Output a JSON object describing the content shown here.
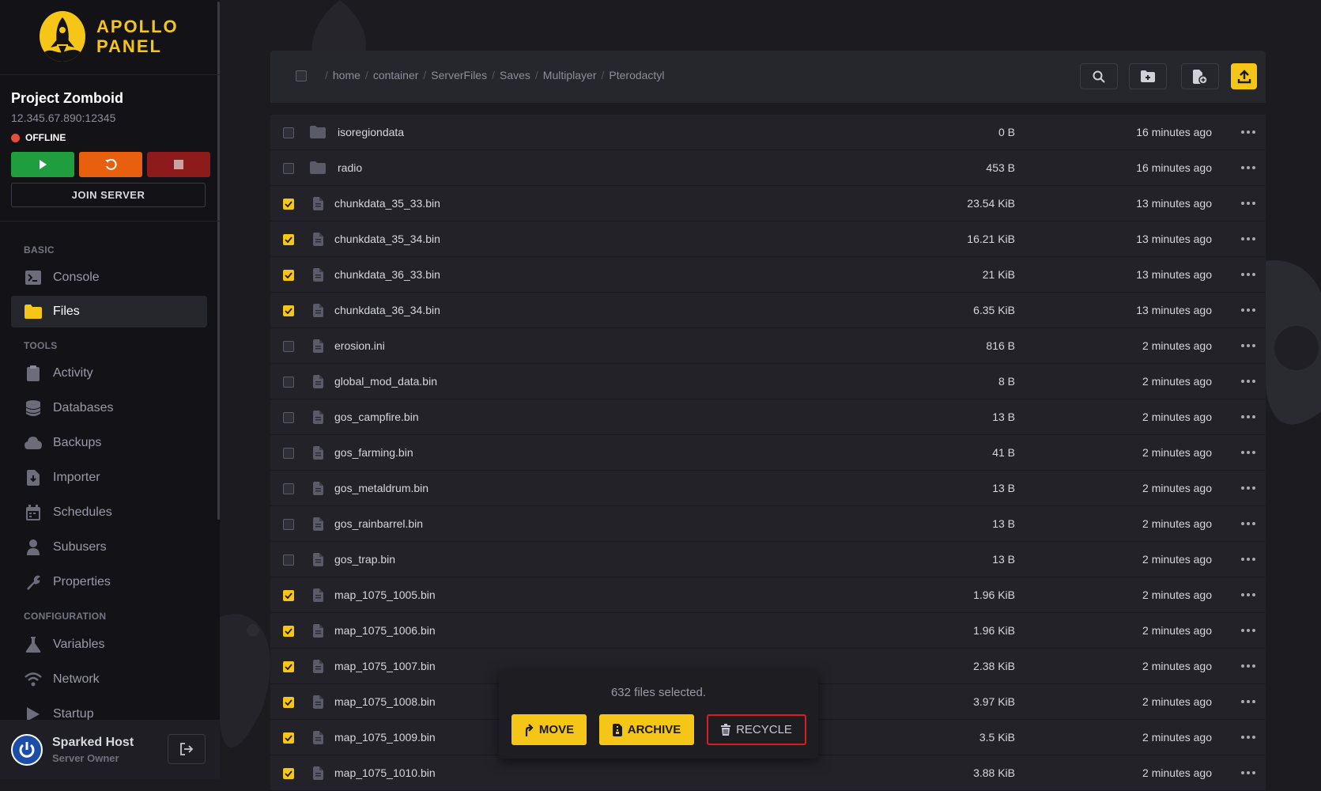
{
  "brand": {
    "line1": "APOLLO",
    "line2": "PANEL"
  },
  "server": {
    "name": "Project Zomboid",
    "address": "12.345.67.890:12345",
    "status": "OFFLINE",
    "join_label": "JOIN SERVER"
  },
  "nav": {
    "basic_label": "BASIC",
    "console": "Console",
    "files": "Files",
    "tools_label": "TOOLS",
    "activity": "Activity",
    "databases": "Databases",
    "backups": "Backups",
    "importer": "Importer",
    "schedules": "Schedules",
    "subusers": "Subusers",
    "properties": "Properties",
    "config_label": "CONFIGURATION",
    "variables": "Variables",
    "network": "Network",
    "startup": "Startup"
  },
  "user": {
    "name": "Sparked Host",
    "role": "Server Owner"
  },
  "breadcrumb": [
    "home",
    "container",
    "ServerFiles",
    "Saves",
    "Multiplayer"
  ],
  "breadcrumb_current": "Pterodactyl",
  "files": [
    {
      "name": "isoregiondata",
      "size": "0 B",
      "modified": "16 minutes ago",
      "type": "folder",
      "checked": false
    },
    {
      "name": "radio",
      "size": "453 B",
      "modified": "16 minutes ago",
      "type": "folder",
      "checked": false
    },
    {
      "name": "chunkdata_35_33.bin",
      "size": "23.54 KiB",
      "modified": "13 minutes ago",
      "type": "file",
      "checked": true
    },
    {
      "name": "chunkdata_35_34.bin",
      "size": "16.21 KiB",
      "modified": "13 minutes ago",
      "type": "file",
      "checked": true
    },
    {
      "name": "chunkdata_36_33.bin",
      "size": "21 KiB",
      "modified": "13 minutes ago",
      "type": "file",
      "checked": true
    },
    {
      "name": "chunkdata_36_34.bin",
      "size": "6.35 KiB",
      "modified": "13 minutes ago",
      "type": "file",
      "checked": true
    },
    {
      "name": "erosion.ini",
      "size": "816 B",
      "modified": "2 minutes ago",
      "type": "file",
      "checked": false
    },
    {
      "name": "global_mod_data.bin",
      "size": "8 B",
      "modified": "2 minutes ago",
      "type": "file",
      "checked": false
    },
    {
      "name": "gos_campfire.bin",
      "size": "13 B",
      "modified": "2 minutes ago",
      "type": "file",
      "checked": false
    },
    {
      "name": "gos_farming.bin",
      "size": "41 B",
      "modified": "2 minutes ago",
      "type": "file",
      "checked": false
    },
    {
      "name": "gos_metaldrum.bin",
      "size": "13 B",
      "modified": "2 minutes ago",
      "type": "file",
      "checked": false
    },
    {
      "name": "gos_rainbarrel.bin",
      "size": "13 B",
      "modified": "2 minutes ago",
      "type": "file",
      "checked": false
    },
    {
      "name": "gos_trap.bin",
      "size": "13 B",
      "modified": "2 minutes ago",
      "type": "file",
      "checked": false
    },
    {
      "name": "map_1075_1005.bin",
      "size": "1.96 KiB",
      "modified": "2 minutes ago",
      "type": "file",
      "checked": true
    },
    {
      "name": "map_1075_1006.bin",
      "size": "1.96 KiB",
      "modified": "2 minutes ago",
      "type": "file",
      "checked": true
    },
    {
      "name": "map_1075_1007.bin",
      "size": "2.38 KiB",
      "modified": "2 minutes ago",
      "type": "file",
      "checked": true
    },
    {
      "name": "map_1075_1008.bin",
      "size": "3.97 KiB",
      "modified": "2 minutes ago",
      "type": "file",
      "checked": true
    },
    {
      "name": "map_1075_1009.bin",
      "size": "3.5 KiB",
      "modified": "2 minutes ago",
      "type": "file",
      "checked": true
    },
    {
      "name": "map_1075_1010.bin",
      "size": "3.88 KiB",
      "modified": "2 minutes ago",
      "type": "file",
      "checked": true
    }
  ],
  "selection": {
    "count_text": "632 files selected.",
    "move": "MOVE",
    "archive": "ARCHIVE",
    "recycle": "RECYCLE"
  },
  "icons": {
    "search": "search-icon",
    "new_folder": "folder-plus-icon",
    "new_file": "file-plus-icon",
    "upload": "upload-icon"
  },
  "colors": {
    "accent": "#f5c518",
    "start": "#1f9d3f",
    "restart": "#e8600e",
    "stop": "#8e1b1b",
    "offline": "#e74c3c",
    "highlight": "#d71f1f"
  }
}
